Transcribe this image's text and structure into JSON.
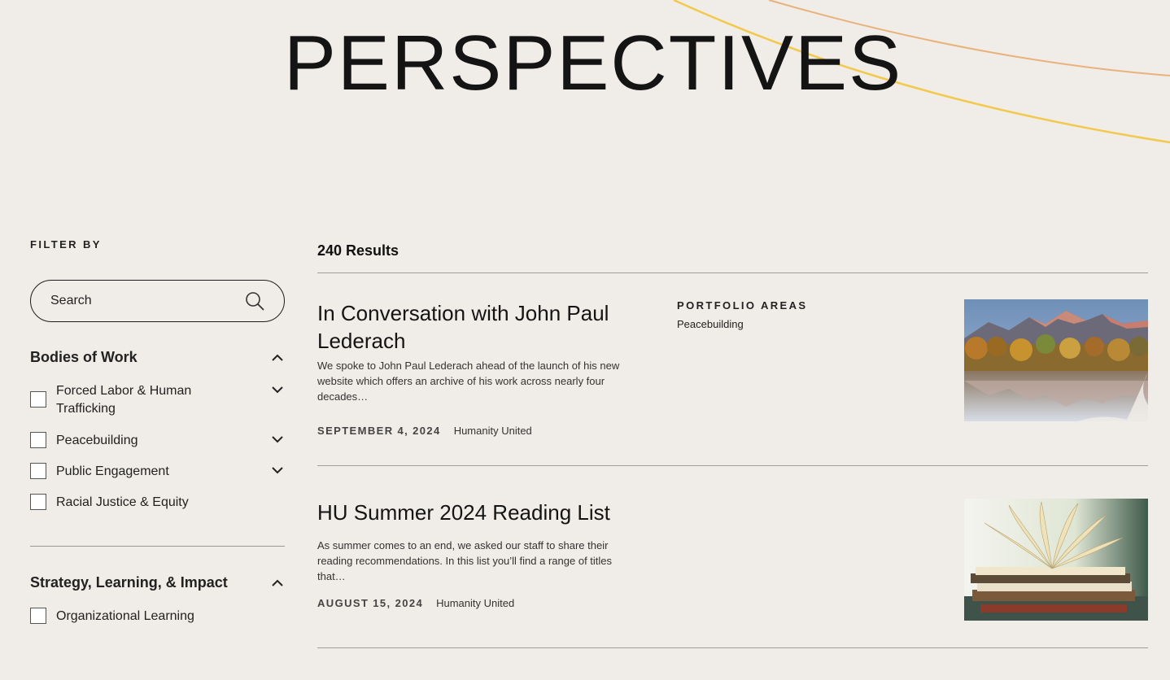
{
  "page": {
    "title": "PERSPECTIVES"
  },
  "colors": {
    "background": "#f0ece7",
    "accent_yellow": "#f2c94c",
    "accent_peach": "#e8b27a"
  },
  "sidebar": {
    "filter_label": "FILTER BY",
    "search": {
      "placeholder": "Search",
      "icon": "search-icon"
    },
    "sections": [
      {
        "title": "Bodies of Work",
        "expanded": true,
        "options": [
          {
            "label": "Forced Labor & Human Trafficking",
            "checked": false,
            "has_children": true
          },
          {
            "label": "Peacebuilding",
            "checked": false,
            "has_children": true
          },
          {
            "label": "Public Engagement",
            "checked": false,
            "has_children": true
          },
          {
            "label": "Racial Justice & Equity",
            "checked": false,
            "has_children": false
          }
        ]
      },
      {
        "title": "Strategy, Learning, & Impact",
        "expanded": true,
        "options": [
          {
            "label": "Organizational Learning",
            "checked": false,
            "has_children": false
          }
        ]
      }
    ]
  },
  "results": {
    "count_label": "240 Results",
    "items": [
      {
        "title": "In Conversation with John Paul Lederach",
        "excerpt": "We spoke to John Paul Lederach ahead of the launch of his new website which offers an archive of his work across nearly four decades…",
        "date": "SEPTEMBER 4, 2024",
        "author": "Humanity United",
        "portfolio_label": "PORTFOLIO AREAS",
        "portfolio_value": "Peacebuilding",
        "image": "mountain-lake-image"
      },
      {
        "title": "HU Summer 2024 Reading List",
        "excerpt": "As summer comes to an end, we asked our staff to share their reading recommendations. In this list you’ll find a range of titles that…",
        "date": "AUGUST 15, 2024",
        "author": "Humanity United",
        "image": "open-books-image"
      }
    ]
  }
}
